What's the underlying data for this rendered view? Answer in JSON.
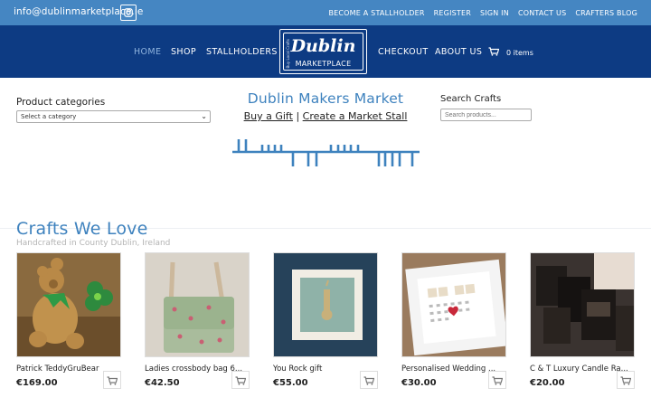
{
  "topbar": {
    "email": "info@dublinmarketplace.ie",
    "instagram_icon": "instagram-icon",
    "links": [
      "BECOME A STALLHOLDER",
      "REGISTER",
      "SIGN IN",
      "CONTACT US",
      "CRAFTERS BLOG"
    ]
  },
  "nav": {
    "home": "HOME",
    "shop": "SHOP",
    "stallholders": "STALLHOLDERS",
    "checkout": "CHECKOUT",
    "about": "ABOUT US",
    "cart_count": "0 items",
    "cart_icon": "basket-icon"
  },
  "logo": {
    "script": "Dublin",
    "sub": "MARKETPLACE",
    "side": "Buy Local Crafts"
  },
  "categories": {
    "title": "Product categories",
    "selected": "Select a category"
  },
  "hero": {
    "title": "Dublin Makers Market",
    "link1": "Buy a Gift",
    "separator": "|",
    "link2": "Create a Market Stall"
  },
  "search": {
    "title": "Search Crafts",
    "placeholder": "Search products..."
  },
  "crafts": {
    "title": "Crafts We Love",
    "subtitle": "Handcrafted in County Dublin, Ireland",
    "products": [
      {
        "name": "Patrick TeddyGruBear",
        "price": "€169.00"
      },
      {
        "name": "Ladies crossbody bag 6...",
        "price": "€42.50"
      },
      {
        "name": "You Rock gift",
        "price": "€55.00"
      },
      {
        "name": "Personalised Wedding ...",
        "price": "€30.00"
      },
      {
        "name": "C & T Luxury Candle Ra...",
        "price": "€20.00"
      }
    ]
  },
  "colors": {
    "topbar": "#4586c2",
    "nav": "#0d3b83",
    "accent": "#3e82be"
  }
}
